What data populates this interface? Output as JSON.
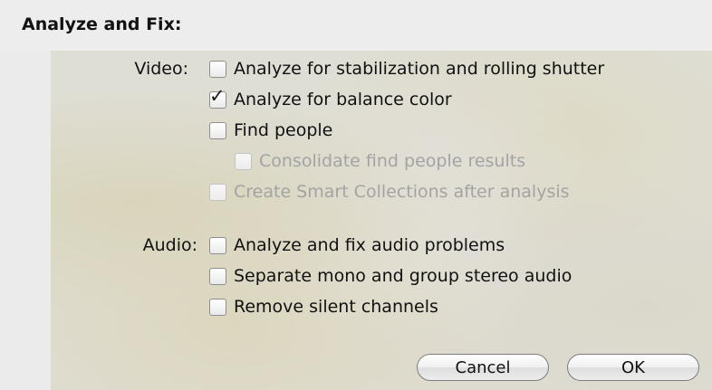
{
  "dialog": {
    "title": "Analyze and Fix:"
  },
  "video": {
    "label": "Video:",
    "options": [
      {
        "label": "Analyze for stabilization and rolling shutter",
        "checked": false,
        "enabled": true
      },
      {
        "label": "Analyze for balance color",
        "checked": true,
        "enabled": true
      },
      {
        "label": "Find people",
        "checked": false,
        "enabled": true
      },
      {
        "label": "Consolidate find people results",
        "checked": false,
        "enabled": false
      },
      {
        "label": "Create Smart Collections after analysis",
        "checked": false,
        "enabled": false
      }
    ]
  },
  "audio": {
    "label": "Audio:",
    "options": [
      {
        "label": "Analyze and fix audio problems",
        "checked": false,
        "enabled": true
      },
      {
        "label": "Separate mono and group stereo audio",
        "checked": false,
        "enabled": true
      },
      {
        "label": "Remove silent channels",
        "checked": false,
        "enabled": true
      }
    ]
  },
  "buttons": {
    "cancel": "Cancel",
    "ok": "OK"
  },
  "icons": {
    "checkmark": "checkmark-icon"
  }
}
